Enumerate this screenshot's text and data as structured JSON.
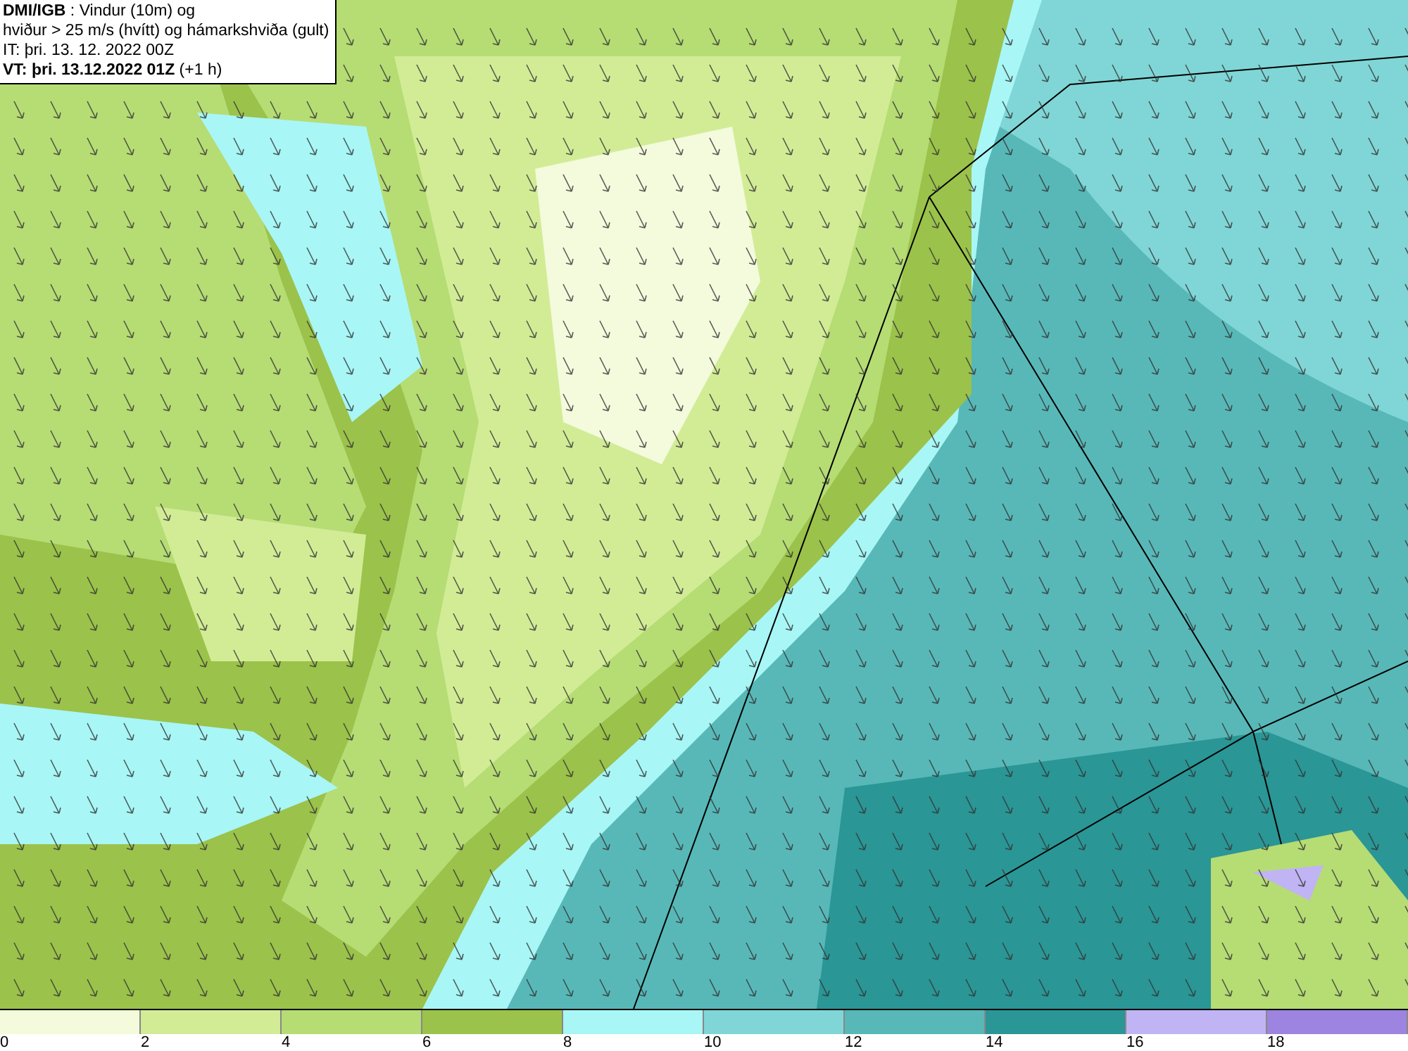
{
  "title_box": {
    "lines": [
      "**DMI/IGB** : Vindur (10m) og",
      "hviður > 25 m/s (hvítt) og hámarkshviða (gult)",
      "IT: þri. 13. 12. 2022 00Z",
      "**VT: þri. 13.12.2022 01Z** (+1 h)"
    ]
  },
  "legend": {
    "swatches": [
      {
        "color": "#f4fadc",
        "label": "0"
      },
      {
        "color": "#d2ec96",
        "label": "2"
      },
      {
        "color": "#b6dc74",
        "label": "4"
      },
      {
        "color": "#9bc24a",
        "label": "6"
      },
      {
        "color": "#a8f6f6",
        "label": "8"
      },
      {
        "color": "#80d6d6",
        "label": "10"
      },
      {
        "color": "#58b8b8",
        "label": "12"
      },
      {
        "color": "#2a9696",
        "label": "14"
      },
      {
        "color": "#c0b4f4",
        "label": "16"
      },
      {
        "color": "#9c84e0",
        "label": "18"
      }
    ]
  }
}
